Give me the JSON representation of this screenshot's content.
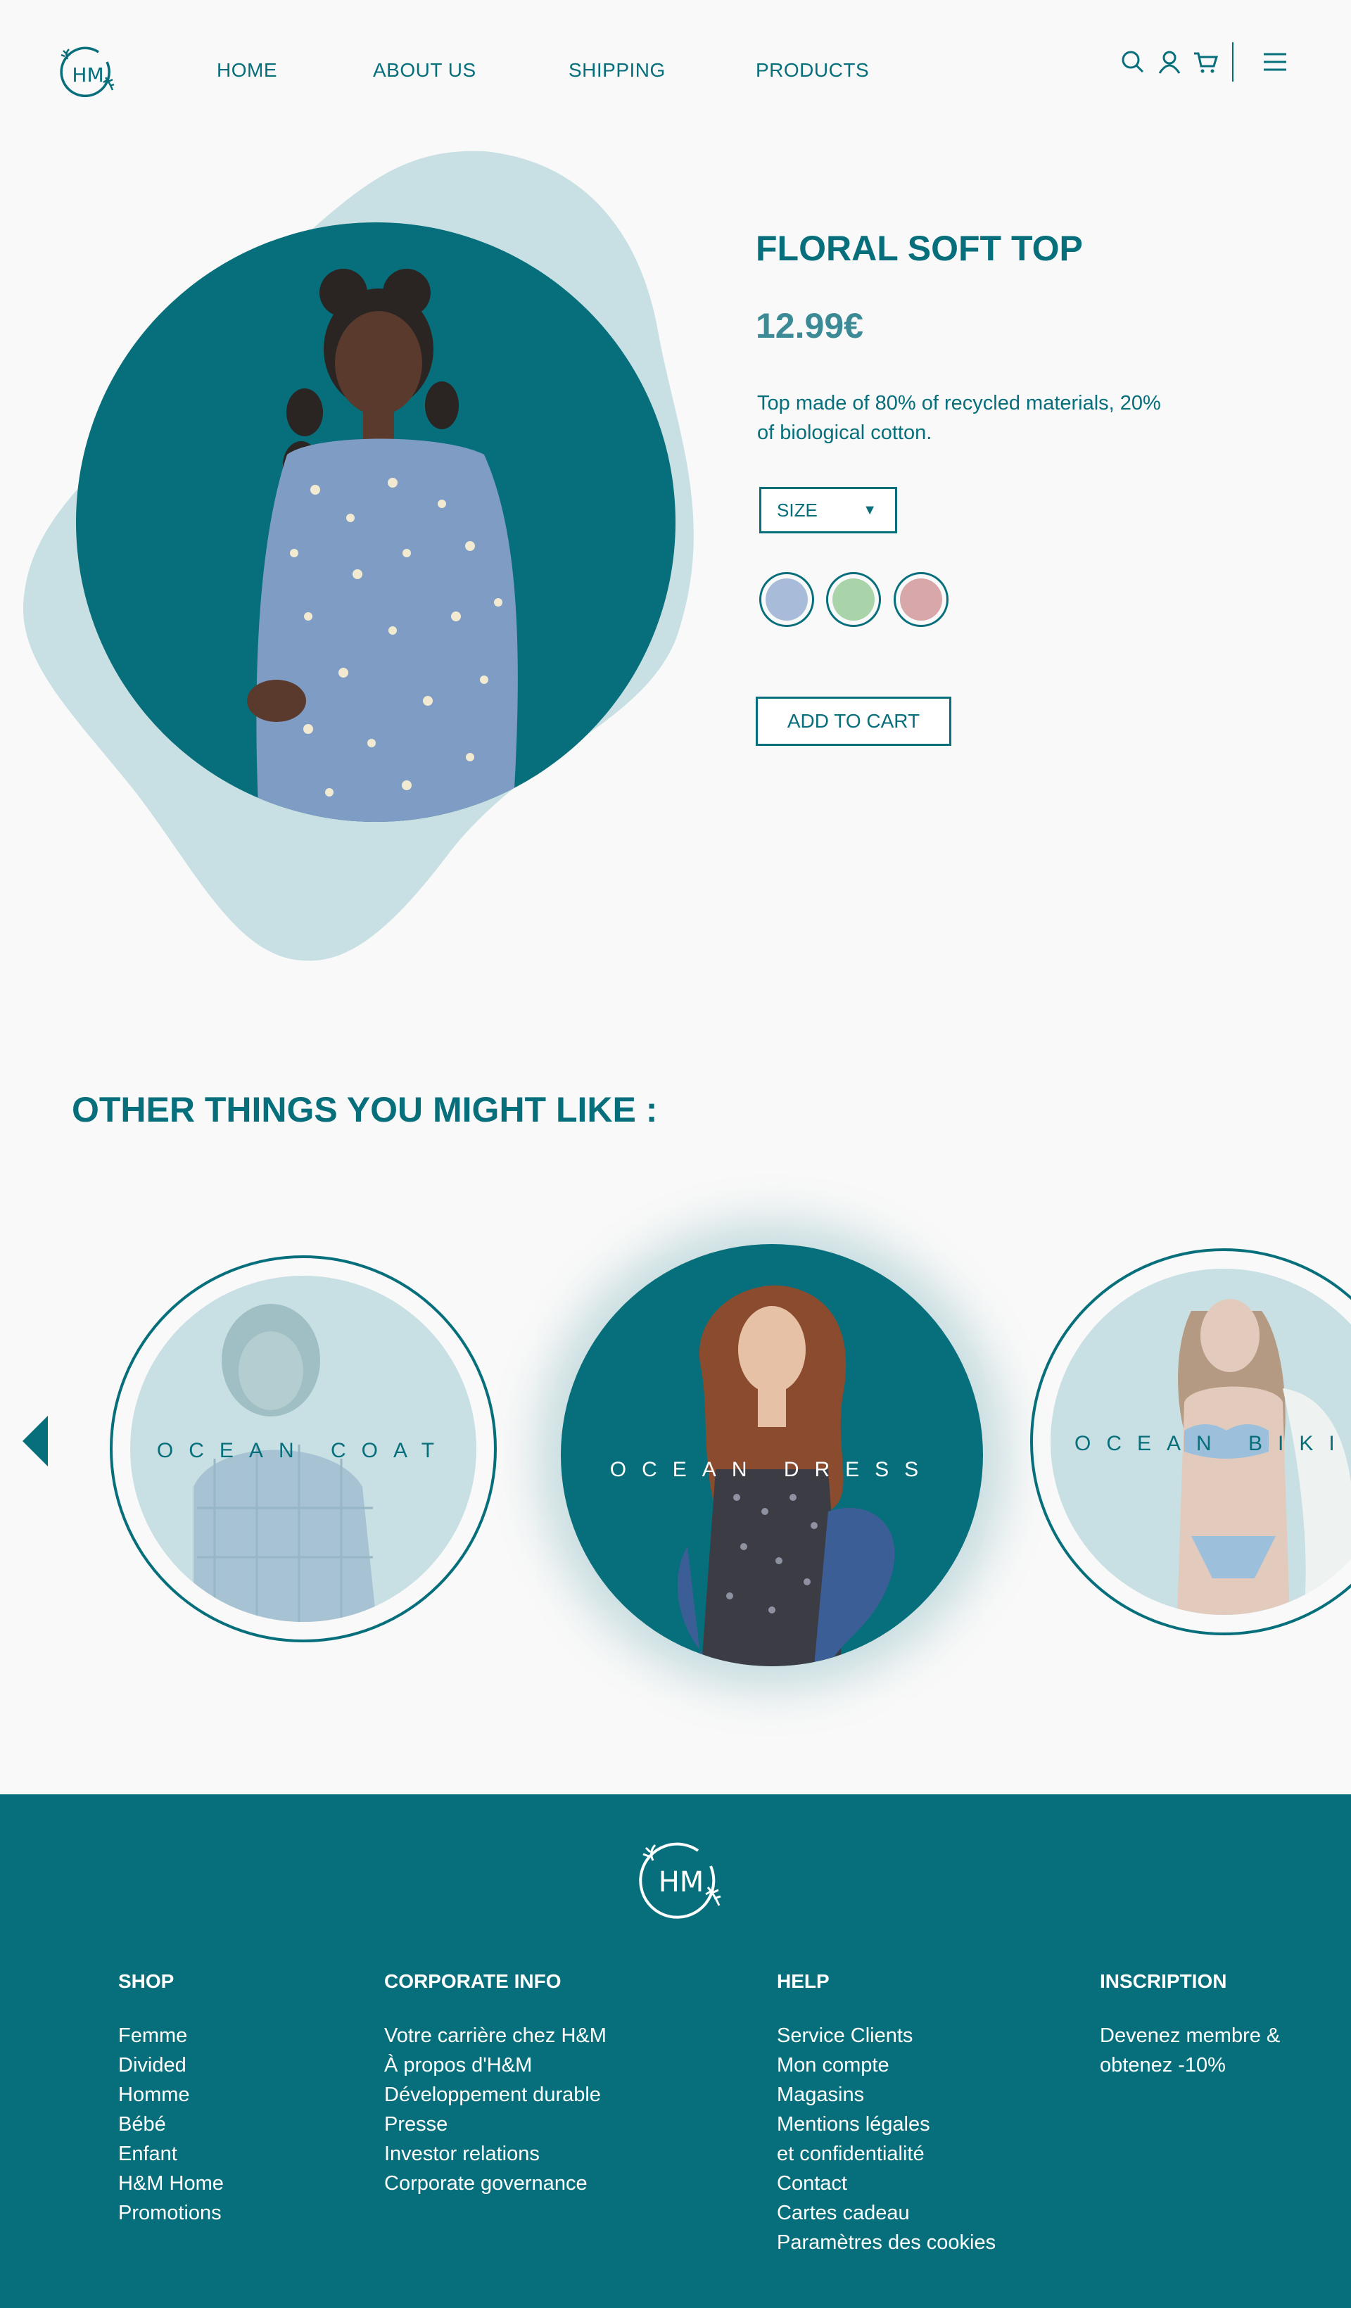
{
  "brand": {
    "logo_text": "HM"
  },
  "nav": {
    "items": [
      "HOME",
      "ABOUT US",
      "SHIPPING",
      "PRODUCTS"
    ]
  },
  "header_icons": [
    "search-icon",
    "user-icon",
    "cart-icon",
    "menu-icon"
  ],
  "product": {
    "title": "FLORAL SOFT TOP",
    "price": "12.99€",
    "description": "Top made of 80% of recycled materials, 20% of biological cotton.",
    "size_label": "SIZE",
    "size_arrow": "▼",
    "colors": [
      "#a8bcd9",
      "#a9d3a8",
      "#d8a7aa"
    ],
    "add_to_cart": "ADD TO CART"
  },
  "recommendations": {
    "title": "OTHER THINGS YOU MIGHT LIKE :",
    "items": [
      "OCEAN COAT",
      "OCEAN DRESS",
      "OCEAN BIKINI"
    ]
  },
  "footer": {
    "columns": [
      {
        "heading": "SHOP",
        "items": [
          "Femme",
          "Divided",
          "Homme",
          "Bébé",
          "Enfant",
          "H&M Home",
          "Promotions"
        ]
      },
      {
        "heading": "CORPORATE INFO",
        "items": [
          "Votre carrière chez H&M",
          "À propos d'H&M",
          "Développement durable",
          "Presse",
          "Investor relations",
          "Corporate governance"
        ]
      },
      {
        "heading": "HELP",
        "items": [
          "Service Clients",
          "Mon compte",
          "Magasins",
          "Mentions légales",
          "et confidentialité",
          "Contact",
          "Cartes cadeau",
          "Paramètres des cookies"
        ]
      },
      {
        "heading": "INSCRIPTION",
        "items": [
          "Devenez membre &",
          "obtenez -10%"
        ]
      }
    ]
  },
  "colors": {
    "brand_teal": "#066f7b",
    "light_teal": "#c8e0e3",
    "price_teal": "#3b8a95",
    "background": "#f9f9f9"
  }
}
